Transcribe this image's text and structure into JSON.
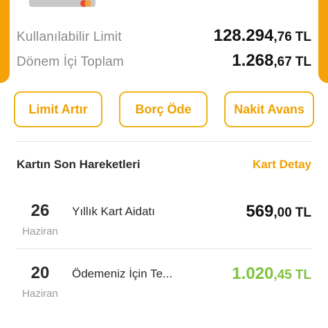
{
  "summary": {
    "available_limit": {
      "label": "Kullanılabilir Limit",
      "amount_int": "128.294",
      "amount_dec": ",76",
      "currency": "TL"
    },
    "period_total": {
      "label": "Dönem İçi Toplam",
      "amount_int": "1.268",
      "amount_dec": ",67",
      "currency": "TL"
    }
  },
  "actions": {
    "increase_limit": "Limit Artır",
    "pay_debt": "Borç Öde",
    "cash_advance": "Nakit Avans"
  },
  "transactions_section": {
    "title": "Kartın Son Hareketleri",
    "detail_link": "Kart Detay"
  },
  "transactions": [
    {
      "day": "26",
      "month": "Haziran",
      "description": "Yıllık Kart Aidatı",
      "amount_int": "569",
      "amount_dec": ",00",
      "currency": "TL"
    },
    {
      "day": "20",
      "month": "Haziran",
      "description": "Ödemeniz İçin Te...",
      "amount_int": "1.020",
      "amount_dec": ",45",
      "currency": "TL"
    }
  ],
  "colors": {
    "accent": "#f0a000",
    "button_border": "#f0b31a",
    "credit_green": "#7fc241",
    "label_grey": "#8a8a8a"
  }
}
